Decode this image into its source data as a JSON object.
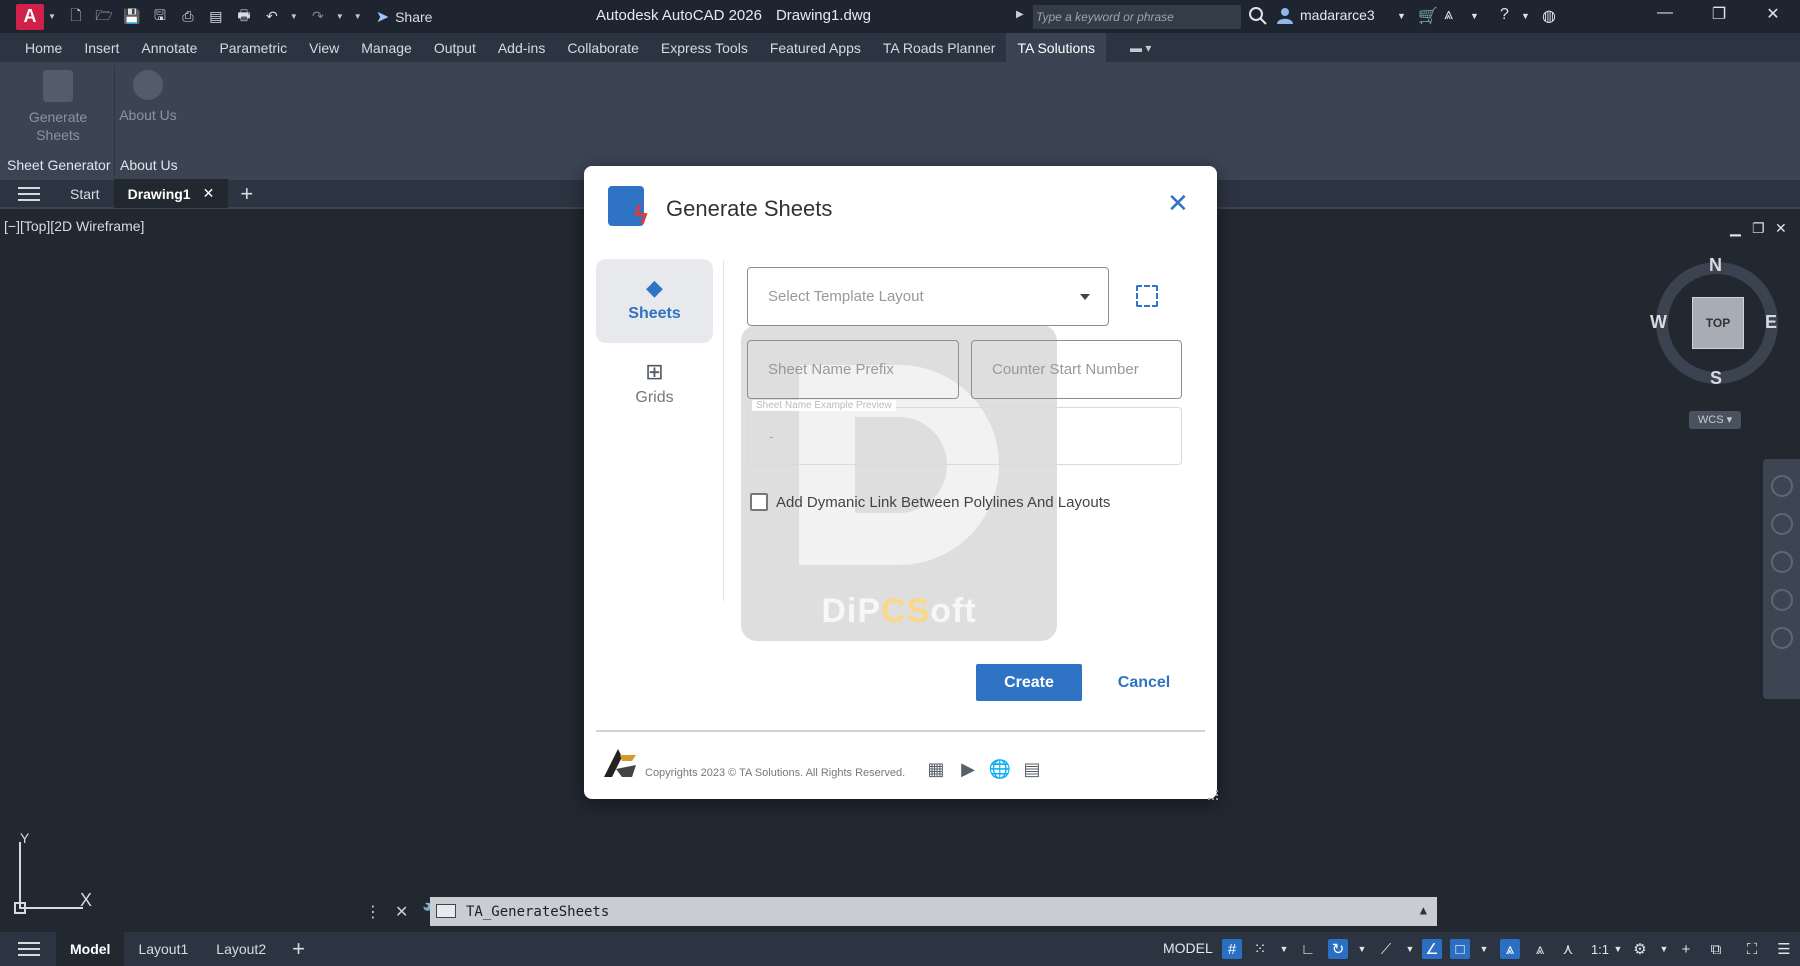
{
  "titlebar": {
    "app_letter": "A",
    "share_label": "Share",
    "app_name": "Autodesk AutoCAD 2026",
    "file_name": "Drawing1.dwg",
    "search_placeholder": "Type a keyword or phrase",
    "user_name": "madararce3"
  },
  "ribbon": {
    "tabs": [
      "Home",
      "Insert",
      "Annotate",
      "Parametric",
      "View",
      "Manage",
      "Output",
      "Add-ins",
      "Collaborate",
      "Express Tools",
      "Featured Apps",
      "TA Roads Planner",
      "TA Solutions"
    ],
    "active_tab": "TA Solutions",
    "buttons": {
      "generate_sheets": "Generate Sheets",
      "about_us": "About Us"
    },
    "panels": {
      "sheet_generator": "Sheet Generator",
      "about_us": "About Us"
    }
  },
  "file_tabs": {
    "start": "Start",
    "drawing": "Drawing1",
    "close_glyph": "✕"
  },
  "viewport": {
    "label": "[−][Top][2D Wireframe]",
    "viewcube_face": "TOP",
    "compass": {
      "n": "N",
      "s": "S",
      "e": "E",
      "w": "W"
    },
    "wcs": "WCS ▾",
    "ucs_x": "X",
    "ucs_y": "Y"
  },
  "command_line": {
    "text": "TA_GenerateSheets"
  },
  "statusbar": {
    "layouts": [
      "Model",
      "Layout1",
      "Layout2"
    ],
    "active_layout": "Model",
    "space": "MODEL",
    "scale": "1:1"
  },
  "dialog": {
    "title": "Generate Sheets",
    "nav": {
      "sheets": "Sheets",
      "grids": "Grids"
    },
    "template_placeholder": "Select Template Layout",
    "prefix_placeholder": "Sheet Name Prefix",
    "counter_placeholder": "Counter Start Number",
    "preview_label": "Sheet Name Example Preview",
    "preview_value": "-",
    "checkbox_label": "Add Dymanic Link Between Polylines And Layouts",
    "checkbox_checked": false,
    "create_label": "Create",
    "cancel_label": "Cancel",
    "copyright": "Copyrights 2023 © TA Solutions. All Rights Reserved.",
    "watermark": {
      "prefix": "DiP",
      "highlight": "CS",
      "suffix": "oft",
      "letter": "D"
    }
  },
  "colors": {
    "accent": "#2f74c4",
    "bolt": "#e53935",
    "app_logo": "#d0214a",
    "background": "#212830"
  }
}
